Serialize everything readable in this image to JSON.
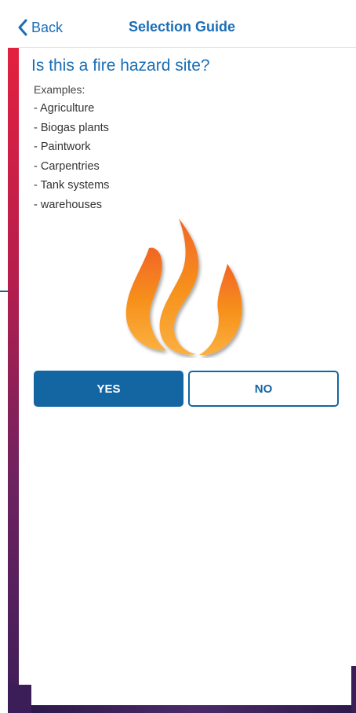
{
  "navbar": {
    "back_label": "Back",
    "title": "Selection Guide"
  },
  "content": {
    "question": "Is this a fire hazard site?",
    "examples_label": "Examples:",
    "examples": [
      "- Agriculture",
      "- Biogas plants",
      "- Paintwork",
      "- Carpentries",
      "- Tank systems",
      "- warehouses"
    ],
    "illustration_icon": "flame-icon"
  },
  "buttons": {
    "yes_label": "YES",
    "no_label": "NO"
  },
  "colors": {
    "accent": "#1a6eb6",
    "button_blue": "#1466a3",
    "strip_top": "#e3213f",
    "strip_bottom": "#3b1e58",
    "flame_orange": "#f7931e"
  }
}
